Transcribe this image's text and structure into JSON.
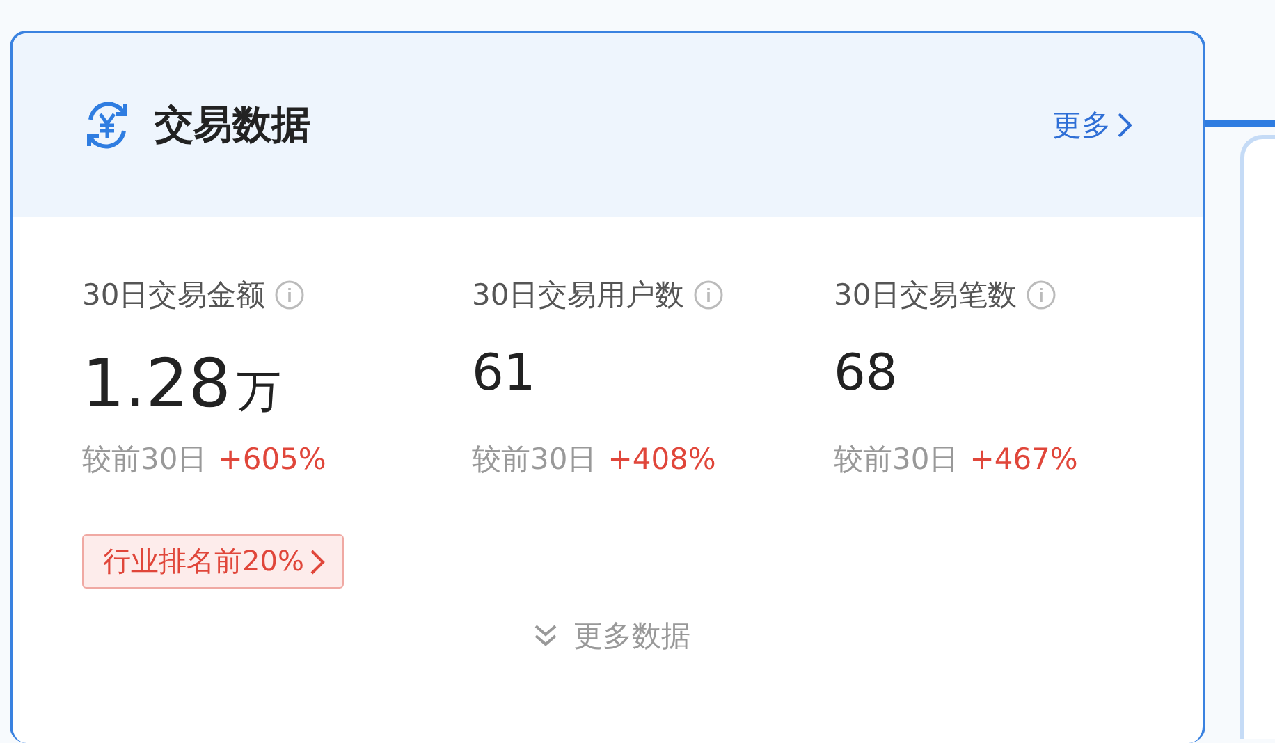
{
  "card": {
    "title": "交易数据",
    "more_link": "更多"
  },
  "metrics": [
    {
      "label": "30日交易金额",
      "value": "1.28",
      "unit": "万",
      "compare_label": "较前30日",
      "delta": "+605%"
    },
    {
      "label": "30日交易用户数",
      "value": "61",
      "compare_label": "较前30日",
      "delta": "+408%"
    },
    {
      "label": "30日交易笔数",
      "value": "68",
      "compare_label": "较前30日",
      "delta": "+467%"
    }
  ],
  "rank_badge": "行业排名前20%",
  "expand_link": "更多数据"
}
